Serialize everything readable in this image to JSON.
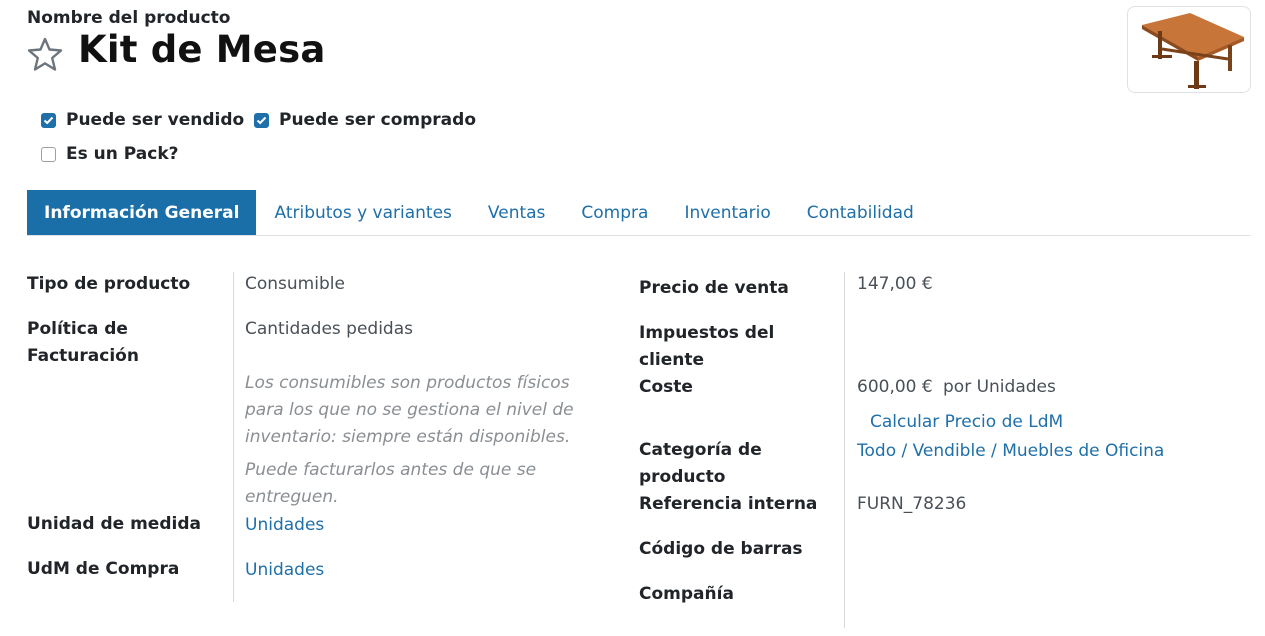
{
  "header": {
    "product_name_label": "Nombre del producto",
    "title": "Kit de Mesa",
    "favorite_icon": "star-outline-icon",
    "image_alt": "product-image"
  },
  "checkboxes": [
    {
      "label": "Puede ser vendido",
      "checked": true
    },
    {
      "label": "Puede ser comprado",
      "checked": true
    },
    {
      "label": "Es un Pack?",
      "checked": false
    }
  ],
  "tabs": [
    {
      "label": "Información General",
      "active": true
    },
    {
      "label": "Atributos y variantes",
      "active": false
    },
    {
      "label": "Ventas",
      "active": false
    },
    {
      "label": "Compra",
      "active": false
    },
    {
      "label": "Inventario",
      "active": false
    },
    {
      "label": "Contabilidad",
      "active": false
    }
  ],
  "left": {
    "product_type": {
      "label": "Tipo de producto",
      "value": "Consumible"
    },
    "invoice_policy": {
      "label_line1": "Política de",
      "label_line2": "Facturación",
      "value": "Cantidades pedidas"
    },
    "help1": [
      "Los consumibles son productos físicos",
      "para los que no se gestiona el nivel de",
      "inventario: siempre están disponibles."
    ],
    "help2": [
      "Puede facturarlos antes de que se",
      "entreguen."
    ],
    "uom": {
      "label": "Unidad de medida",
      "value": "Unidades"
    },
    "purchase_uom": {
      "label": "UdM de Compra",
      "value": "Unidades"
    }
  },
  "right": {
    "sale_price": {
      "label": "Precio de venta",
      "value": "147,00 €"
    },
    "customer_taxes": {
      "label_line1": "Impuestos del",
      "label_line2": "cliente"
    },
    "cost": {
      "label": "Coste",
      "value": "600,00 €",
      "unit": "por Unidades",
      "compute_link": "Calcular Precio de LdM"
    },
    "category": {
      "label_line1": "Categoría de",
      "label_line2": "producto",
      "value": "Todo / Vendible / Muebles de Oficina"
    },
    "internal_ref": {
      "label": "Referencia interna",
      "value": "FURN_78236"
    },
    "barcode": {
      "label": "Código de barras"
    },
    "company": {
      "label": "Compañía"
    }
  },
  "colors": {
    "accent": "#1a6fa8",
    "link": "#1f6fa8",
    "muted": "#8a8f94"
  }
}
